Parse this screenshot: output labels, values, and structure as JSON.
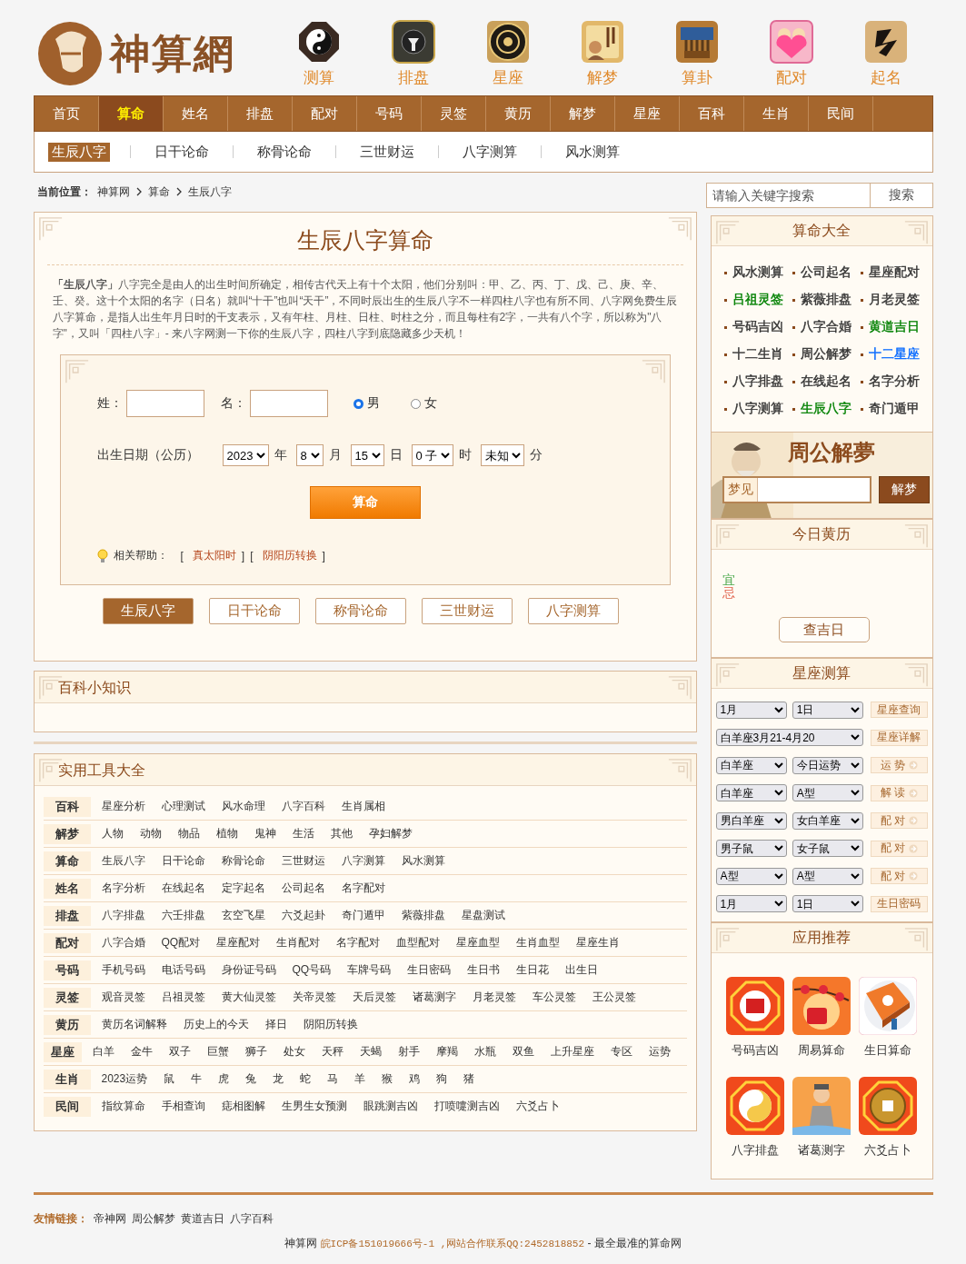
{
  "logo": {
    "text": "神算網"
  },
  "feature_icons": [
    {
      "label": "测算",
      "kind": "yinyang"
    },
    {
      "label": "排盘",
      "kind": "plate"
    },
    {
      "label": "星座",
      "kind": "wheel"
    },
    {
      "label": "解梦",
      "kind": "scroll"
    },
    {
      "label": "算卦",
      "kind": "sticks"
    },
    {
      "label": "配对",
      "kind": "heart"
    },
    {
      "label": "起名",
      "kind": "brush"
    }
  ],
  "nav": [
    {
      "label": "首页",
      "selected": false
    },
    {
      "label": "算命",
      "selected": true
    },
    {
      "label": "姓名",
      "selected": false
    },
    {
      "label": "排盘",
      "selected": false
    },
    {
      "label": "配对",
      "selected": false
    },
    {
      "label": "号码",
      "selected": false
    },
    {
      "label": "灵签",
      "selected": false
    },
    {
      "label": "黄历",
      "selected": false
    },
    {
      "label": "解梦",
      "selected": false
    },
    {
      "label": "星座",
      "selected": false
    },
    {
      "label": "百科",
      "selected": false
    },
    {
      "label": "生肖",
      "selected": false
    },
    {
      "label": "民间",
      "selected": false
    }
  ],
  "subnav": [
    {
      "label": "生辰八字",
      "selected": true
    },
    {
      "label": "日干论命",
      "selected": false
    },
    {
      "label": "称骨论命",
      "selected": false
    },
    {
      "label": "三世财运",
      "selected": false
    },
    {
      "label": "八字测算",
      "selected": false
    },
    {
      "label": "风水测算",
      "selected": false
    }
  ],
  "breadcrumb": {
    "label": "当前位置：",
    "items": [
      "神算网",
      "算命",
      "生辰八字"
    ]
  },
  "search": {
    "placeholder": "请输入关键字搜索",
    "button": "搜索"
  },
  "main": {
    "title": "生辰八字算命",
    "description": "**「生辰八字」**八字完全是由人的出生时间所确定，相传古代天上有十个太阳，他们分别叫：甲、乙、丙、丁、戊、己、庚、辛、壬、癸。这十个太阳的名字（日名）就叫“十干”也叫“天干”，不同时辰出生的生辰八字不一样四柱八字也有所不同、八字网免费生辰八字算命，是指人出生年月日时的干支表示，又有年柱、月柱、日柱、时柱之分，而且每柱有2字，一共有八个字，所以称为\"八字\"，又叫「四柱八字」- 来八字网测一下你的生辰八字，四柱八字到底隐藏多少天机！"
  },
  "form": {
    "surname_label": "姓：",
    "name_label": "名：",
    "genders": [
      {
        "label": "男",
        "selected": true
      },
      {
        "label": "女",
        "selected": false
      }
    ],
    "date_label": "出生日期（公历）",
    "selects": [
      {
        "value": "2023",
        "unit": "年"
      },
      {
        "value": "8",
        "unit": "月"
      },
      {
        "value": "15",
        "unit": "日"
      },
      {
        "value": "0 子",
        "unit": "时"
      },
      {
        "value": "未知",
        "unit": "分"
      }
    ],
    "submit": "算命",
    "help_label": "相关帮助：",
    "help_links": [
      {
        "open": "[",
        "label": "真太阳时",
        "close": "]"
      },
      {
        "open": "[",
        "label": "阴阳历转换",
        "close": "]"
      }
    ]
  },
  "tabs": [
    {
      "label": "生辰八字",
      "selected": true
    },
    {
      "label": "日干论命",
      "selected": false
    },
    {
      "label": "称骨论命",
      "selected": false
    },
    {
      "label": "三世财运",
      "selected": false
    },
    {
      "label": "八字测算",
      "selected": false
    }
  ],
  "knowledge": {
    "title": "百科小知识"
  },
  "tools": {
    "title": "实用工具大全",
    "rows": [
      {
        "category": "百科",
        "links": [
          "星座分析",
          "心理测试",
          "风水命理",
          "八字百科",
          "生肖属相"
        ]
      },
      {
        "category": "解梦",
        "links": [
          "人物",
          "动物",
          "物品",
          "植物",
          "鬼神",
          "生活",
          "其他",
          "孕妇解梦"
        ]
      },
      {
        "category": "算命",
        "links": [
          "生辰八字",
          "日干论命",
          "称骨论命",
          "三世财运",
          "八字测算",
          "风水测算"
        ]
      },
      {
        "category": "姓名",
        "links": [
          "名字分析",
          "在线起名",
          "定字起名",
          "公司起名",
          "名字配对"
        ]
      },
      {
        "category": "排盘",
        "links": [
          "八字排盘",
          "六壬排盘",
          "玄空飞星",
          "六爻起卦",
          "奇门遁甲",
          "紫薇排盘",
          "星盘测试"
        ]
      },
      {
        "category": "配对",
        "links": [
          "八字合婚",
          "QQ配对",
          "星座配对",
          "生肖配对",
          "名字配对",
          "血型配对",
          "星座血型",
          "生肖血型",
          "星座生肖"
        ]
      },
      {
        "category": "号码",
        "links": [
          "手机号码",
          "电话号码",
          "身份证号码",
          "QQ号码",
          "车牌号码",
          "生日密码",
          "生日书",
          "生日花",
          "出生日"
        ]
      },
      {
        "category": "灵签",
        "links": [
          "观音灵签",
          "吕祖灵签",
          "黄大仙灵签",
          "关帝灵签",
          "天后灵签",
          "诸葛测字",
          "月老灵签",
          "车公灵签",
          "王公灵签"
        ]
      },
      {
        "category": "黄历",
        "links": [
          "黄历名词解释",
          "历史上的今天",
          "择日",
          "阴阳历转换"
        ]
      },
      {
        "category": "星座",
        "links": [
          "白羊",
          "金牛",
          "双子",
          "巨蟹",
          "狮子",
          "处女",
          "天秤",
          "天蝎",
          "射手",
          "摩羯",
          "水瓶",
          "双鱼",
          "上升星座",
          "专区",
          "运势"
        ]
      },
      {
        "category": "生肖",
        "links": [
          "2023运势",
          "鼠",
          "牛",
          "虎",
          "兔",
          "龙",
          "蛇",
          "马",
          "羊",
          "猴",
          "鸡",
          "狗",
          "猪"
        ]
      },
      {
        "category": "民间",
        "links": [
          "指纹算命",
          "手相查询",
          "痣相图解",
          "生男生女预测",
          "眼跳测吉凶",
          "打喷嚏测吉凶",
          "六爻占卜"
        ]
      }
    ]
  },
  "fortune_all": {
    "title": "算命大全",
    "links": [
      {
        "label": "风水测算",
        "color": "#333333"
      },
      {
        "label": "公司起名",
        "color": "#333333"
      },
      {
        "label": "星座配对",
        "color": "#333333"
      },
      {
        "label": "吕祖灵签",
        "color": "#008000"
      },
      {
        "label": "紫薇排盘",
        "color": "#333333"
      },
      {
        "label": "月老灵签",
        "color": "#333333"
      },
      {
        "label": "号码吉凶",
        "color": "#333333"
      },
      {
        "label": "八字合婚",
        "color": "#333333"
      },
      {
        "label": "黄道吉日",
        "color": "#008000"
      },
      {
        "label": "十二生肖",
        "color": "#333333"
      },
      {
        "label": "周公解梦",
        "color": "#333333"
      },
      {
        "label": "十二星座",
        "color": "#0066ff"
      },
      {
        "label": "八字排盘",
        "color": "#333333"
      },
      {
        "label": "在线起名",
        "color": "#333333"
      },
      {
        "label": "名字分析",
        "color": "#333333"
      },
      {
        "label": "八字测算",
        "color": "#333333"
      },
      {
        "label": "生辰八字",
        "color": "#008000"
      },
      {
        "label": "奇门遁甲",
        "color": "#333333"
      }
    ]
  },
  "dream": {
    "title": "周公解夢",
    "prefix": "梦见",
    "button": "解梦"
  },
  "almanac": {
    "title": "今日黄历",
    "marks": [
      "宜",
      "忌"
    ],
    "button": "查吉日"
  },
  "horoscope": {
    "title": "星座测算",
    "rows": [
      {
        "selects": [
          "1月",
          "1日"
        ],
        "button": "星座查询",
        "arrow": false
      },
      {
        "selects": [
          "白羊座3月21-4月20"
        ],
        "button": "星座详解",
        "arrow": false
      },
      {
        "selects": [
          "白羊座",
          "今日运势"
        ],
        "button": "运 势",
        "arrow": true
      },
      {
        "selects": [
          "白羊座",
          "A型"
        ],
        "button": "解 读",
        "arrow": true
      },
      {
        "selects": [
          "男白羊座",
          "女白羊座"
        ],
        "button": "配 对",
        "arrow": true
      },
      {
        "selects": [
          "男子鼠",
          "女子鼠"
        ],
        "button": "配 对",
        "arrow": true
      },
      {
        "selects": [
          "A型",
          "A型"
        ],
        "button": "配 对",
        "arrow": true
      },
      {
        "selects": [
          "1月",
          "1日"
        ],
        "button": "生日密码",
        "arrow": false
      }
    ]
  },
  "apps": {
    "title": "应用推荐",
    "items": [
      {
        "label": "号码吉凶",
        "kind": "seal"
      },
      {
        "label": "周易算命",
        "kind": "blossom"
      },
      {
        "label": "生日算命",
        "kind": "book"
      },
      {
        "label": "八字排盘",
        "kind": "yinyang"
      },
      {
        "label": "诸葛测字",
        "kind": "sage"
      },
      {
        "label": "六爻占卜",
        "kind": "coin"
      }
    ]
  },
  "footer": {
    "links_label": "友情链接：",
    "links": [
      "帝神网",
      "周公解梦",
      "黄道吉日",
      "八字百科"
    ],
    "site": "神算网",
    "icp": "皖ICP备151019666号-1 ,网站合作联系QQ:2452818852",
    "tail": "- 最全最准的算命网"
  }
}
